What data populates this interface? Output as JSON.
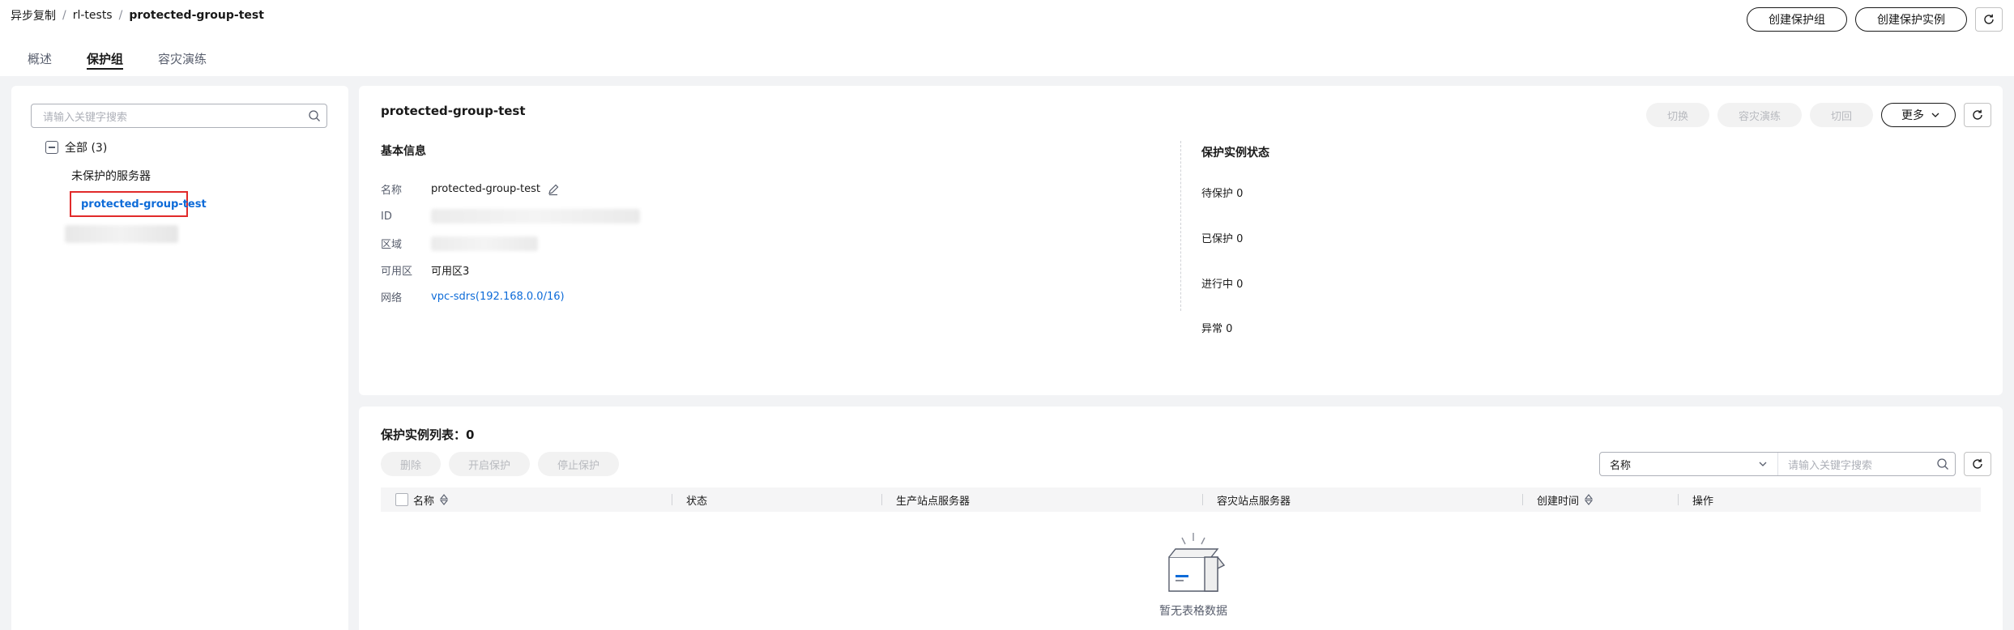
{
  "breadcrumb": {
    "items": [
      "异步复制",
      "rl-tests"
    ],
    "separator": "/",
    "current": "protected-group-test"
  },
  "header": {
    "create_group_label": "创建保护组",
    "create_instance_label": "创建保护实例",
    "refresh_icon": "refresh-icon"
  },
  "tabs": [
    {
      "label": "概述",
      "active": false
    },
    {
      "label": "保护组",
      "active": true
    },
    {
      "label": "容灾演练",
      "active": false
    }
  ],
  "sidebar": {
    "search_placeholder": "请输入关键字搜索",
    "root_label": "全部 (3)",
    "items": [
      {
        "label": "未保护的服务器"
      },
      {
        "label": "protected-group-test",
        "selected": true
      }
    ]
  },
  "detail": {
    "title": "protected-group-test",
    "actions": {
      "switch": "切换",
      "drill": "容灾演练",
      "switchback": "切回",
      "more": "更多"
    },
    "basic_info_title": "基本信息",
    "fields": {
      "name_label": "名称",
      "name_value": "protected-group-test",
      "id_label": "ID",
      "region_label": "区域",
      "az_label": "可用区",
      "az_value": "可用区3",
      "network_label": "网络",
      "network_value": "vpc-sdrs(192.168.0.0/16)"
    },
    "status_title": "保护实例状态",
    "status": [
      {
        "label": "待保护 0"
      },
      {
        "label": "已保护 0"
      },
      {
        "label": "进行中 0"
      },
      {
        "label": "异常 0"
      }
    ]
  },
  "instances": {
    "title": "保护实例列表：0",
    "actions": {
      "delete": "删除",
      "start": "开启保护",
      "stop": "停止保护"
    },
    "filter": {
      "field": "名称",
      "placeholder": "请输入关键字搜索"
    },
    "columns": [
      "名称",
      "状态",
      "生产站点服务器",
      "容灾站点服务器",
      "创建时间",
      "操作"
    ],
    "empty_text": "暂无表格数据"
  },
  "colors": {
    "link": "#0d6bd8",
    "highlight_border": "#e12a2a",
    "background": "#f2f3f5"
  }
}
